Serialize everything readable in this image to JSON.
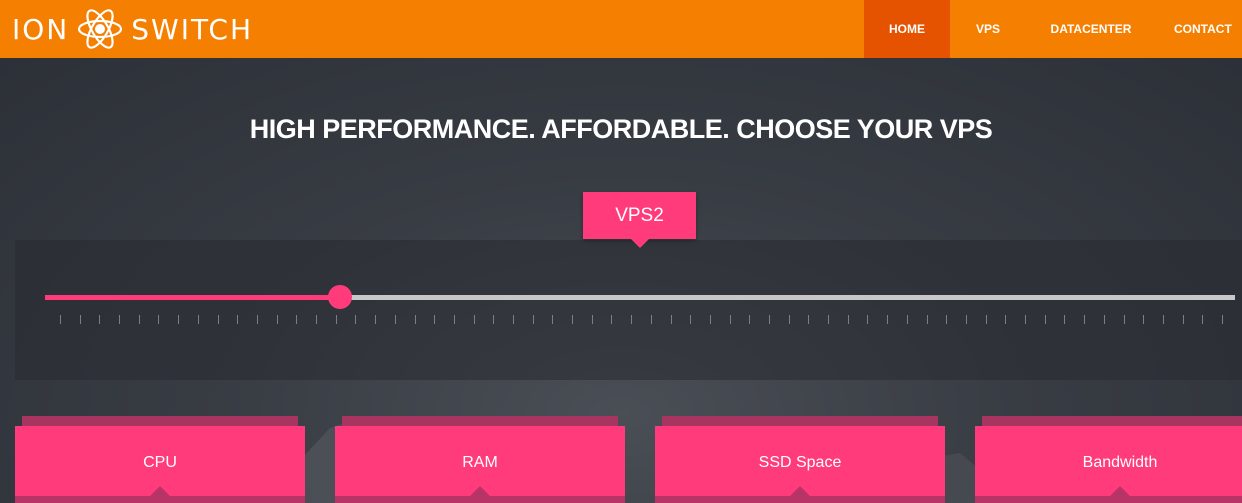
{
  "header": {
    "logo_left": "ION",
    "logo_right": "SWITCH",
    "logo_icon": "atom-icon",
    "nav": [
      {
        "label": "HOME",
        "active": true
      },
      {
        "label": "VPS",
        "active": false
      },
      {
        "label": "DATACENTER",
        "active": false
      },
      {
        "label": "CONTACT",
        "active": false
      }
    ]
  },
  "main": {
    "headline": "HIGH PERFORMANCE. AFFORDABLE. CHOOSE YOUR VPS",
    "slider": {
      "selected_label": "VPS2",
      "value_fraction": 0.248,
      "tick_count": 60
    },
    "cards": [
      {
        "label": "CPU"
      },
      {
        "label": "RAM"
      },
      {
        "label": "SSD Space"
      },
      {
        "label": "Bandwidth"
      }
    ]
  },
  "colors": {
    "header": "#f57f00",
    "nav_active": "#e55300",
    "accent": "#ff3b7c",
    "track": "#c7c7c7"
  }
}
